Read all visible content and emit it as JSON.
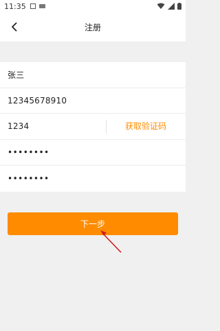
{
  "status_bar": {
    "time": "11:35"
  },
  "header": {
    "title": "注册"
  },
  "form": {
    "name": "张三",
    "phone": "12345678910",
    "code": "1234",
    "password": "••••••••",
    "confirm_password": "••••••••",
    "get_code_label": "获取验证码"
  },
  "next_button": {
    "label": "下一步"
  },
  "colors": {
    "accent": "#ff8c00",
    "annotation": "#d11a1a"
  }
}
